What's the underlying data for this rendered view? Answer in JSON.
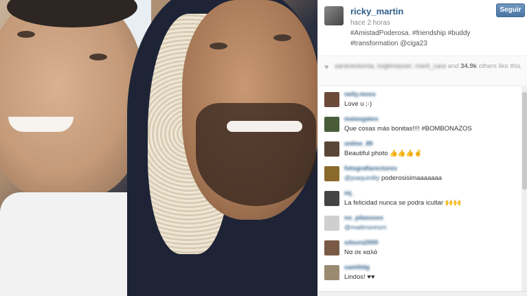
{
  "post": {
    "username": "ricky_martin",
    "follow_label": "Seguir",
    "time_ago": "hace 2 horas",
    "caption_line1": "#AmistadPoderosa. #friendship #buddy",
    "caption_line2": "#transformation @ciga23"
  },
  "likes": {
    "names": "saraneolomia, luiglimasser, marti_cara",
    "and_label": "and",
    "count": "34.9k",
    "suffix": "others like this."
  },
  "comments": [
    {
      "user": "nelly.moss",
      "text": "Love u ;-)",
      "mention": "",
      "avatar_color": "#6b4a3a"
    },
    {
      "user": "maiasgatos",
      "text": "Que cosas más bonitas!!!! #BOMBONAZOS",
      "mention": "",
      "avatar_color": "#4a5d3a"
    },
    {
      "user": "online_89",
      "text": "Beautiful photo 👍👍👍✌",
      "mention": "",
      "avatar_color": "#5a4634"
    },
    {
      "user": "fotografiarectures",
      "text": "poderosisimaaaaaaa",
      "mention": "@joaquinlily",
      "avatar_color": "#8a6a2a"
    },
    {
      "user": "mj_",
      "text": "La felicidad nunca se podra icultar 🙌🙌",
      "mention": "",
      "avatar_color": "#444444"
    },
    {
      "user": "no_pilasoses",
      "text": "",
      "mention": "@mailmoresm",
      "avatar_color": "#cfcfcf"
    },
    {
      "user": "sdsura2000",
      "text": "Να σε καλά",
      "mention": "",
      "avatar_color": "#7a5a44"
    },
    {
      "user": "samlitdg",
      "text": "Lindos! ♥♥",
      "mention": "",
      "avatar_color": "#9a8a70"
    }
  ],
  "icons": {
    "heart": "♥"
  }
}
